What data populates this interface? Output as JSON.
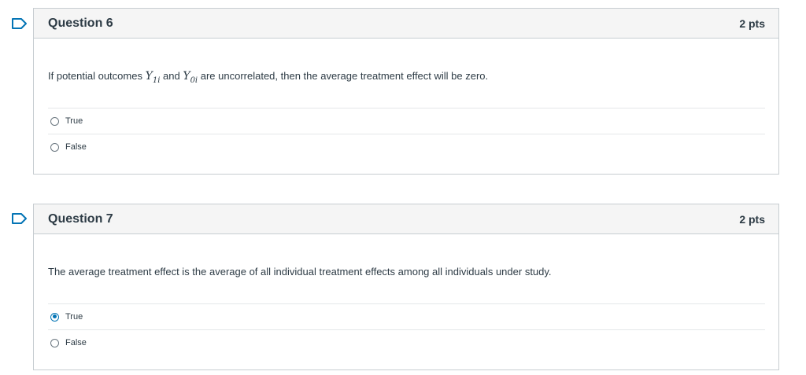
{
  "questions": [
    {
      "title": "Question 6",
      "points": "2 pts",
      "text_before": "If potential outcomes ",
      "y1": "Y",
      "y1_sub": "1i",
      "text_and": " and ",
      "y0": "Y",
      "y0_sub": "0i",
      "text_after": " are uncorrelated, then the average treatment effect will be zero.",
      "answers": [
        {
          "label": "True",
          "selected": false
        },
        {
          "label": "False",
          "selected": false
        }
      ]
    },
    {
      "title": "Question 7",
      "points": "2 pts",
      "text": "The average treatment effect is the average of all individual treatment effects among all individuals under study.",
      "answers": [
        {
          "label": "True",
          "selected": true
        },
        {
          "label": "False",
          "selected": false
        }
      ]
    }
  ],
  "colors": {
    "flag": "#0374b5",
    "accent": "#0374b5",
    "header_bg": "#f5f5f5",
    "border": "#c7cdd1"
  },
  "icons": {
    "flag": "flag-question-icon"
  }
}
